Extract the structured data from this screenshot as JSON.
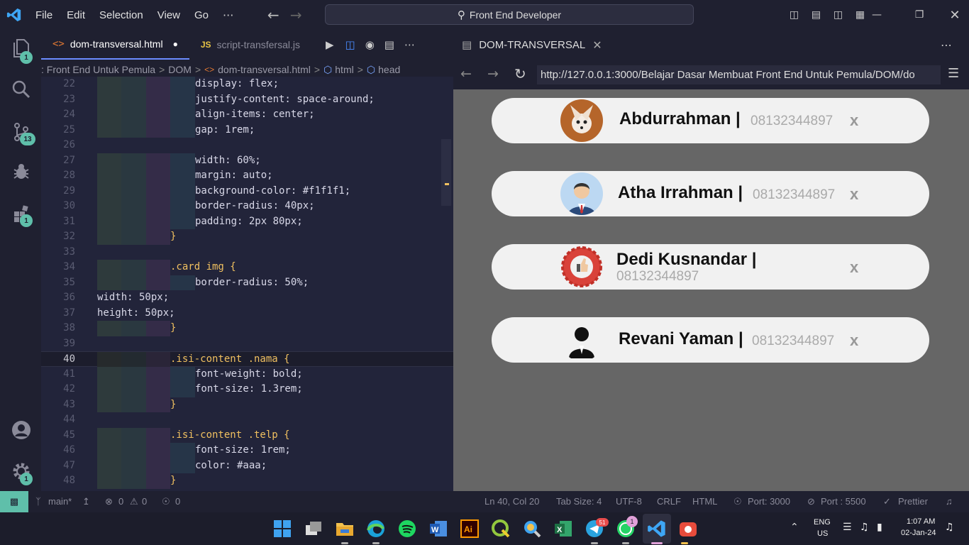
{
  "menu": {
    "file": "File",
    "edit": "Edit",
    "selection": "Selection",
    "view": "View",
    "go": "Go",
    "more": "···"
  },
  "search": {
    "text": "Front End Developer"
  },
  "activity": {
    "explorer_badge": "1",
    "scm_badge": "13",
    "extensions_badge": "1",
    "settings_badge": "1"
  },
  "editor_tabs": [
    {
      "label": "dom-transversal.html",
      "icon": "html-icon"
    },
    {
      "label": "script-transfersal.js",
      "icon": "JS"
    }
  ],
  "breadcrumb": [
    ": Front End Untuk Pemula",
    ">",
    "DOM",
    ">",
    "dom-transversal.html",
    ">",
    "html",
    ">",
    "head"
  ],
  "code_lines": [
    {
      "n": "22",
      "t": "display: flex;"
    },
    {
      "n": "23",
      "t": "justify-content: space-around;"
    },
    {
      "n": "24",
      "t": "align-items: center;"
    },
    {
      "n": "25",
      "t": "gap: 1rem;"
    },
    {
      "n": "26",
      "t": ""
    },
    {
      "n": "27",
      "t": "width: 60%;"
    },
    {
      "n": "28",
      "t": "margin: auto;"
    },
    {
      "n": "29",
      "t": "background-color: #f1f1f1;"
    },
    {
      "n": "30",
      "t": "border-radius: 40px;"
    },
    {
      "n": "31",
      "t": "padding: 2px 80px;"
    },
    {
      "n": "32",
      "t": "}"
    },
    {
      "n": "33",
      "t": ""
    },
    {
      "n": "34",
      "t": ".card img {"
    },
    {
      "n": "35",
      "t": "border-radius: 50%;"
    },
    {
      "n": "36",
      "t": "width: 50px;"
    },
    {
      "n": "37",
      "t": "height: 50px;"
    },
    {
      "n": "38",
      "t": "}"
    },
    {
      "n": "39",
      "t": ""
    },
    {
      "n": "40",
      "t": ".isi-content .nama {"
    },
    {
      "n": "41",
      "t": "font-weight: bold;"
    },
    {
      "n": "42",
      "t": "font-size: 1.3rem;"
    },
    {
      "n": "43",
      "t": "}"
    },
    {
      "n": "44",
      "t": ""
    },
    {
      "n": "45",
      "t": ".isi-content .telp {"
    },
    {
      "n": "46",
      "t": "font-size: 1rem;"
    },
    {
      "n": "47",
      "t": "color: #aaa;"
    },
    {
      "n": "48",
      "t": "}"
    }
  ],
  "browser": {
    "tab_title": "DOM-TRANSVERSAL",
    "url": "http://127.0.0.1:3000/Belajar Dasar Membuat Front End Untuk Pemula/DOM/do",
    "cards": [
      {
        "name": "Abdurrahman |",
        "phone": "08132344897",
        "close": "x"
      },
      {
        "name": "Atha Irrahman |",
        "phone": "08132344897",
        "close": "x"
      },
      {
        "name": "Dedi Kusnandar |",
        "phone": "08132344897",
        "close": "x"
      },
      {
        "name": "Revani Yaman |",
        "phone": "08132344897",
        "close": "x"
      }
    ]
  },
  "status": {
    "branch": "main*",
    "errors": "0",
    "warnings": "0",
    "ports": "0",
    "position": "Ln 40, Col 20",
    "tab_size": "Tab Size: 4",
    "encoding": "UTF-8",
    "eol": "CRLF",
    "language": "HTML",
    "port": "Port: 3000",
    "port2": "Port : 5500",
    "prettier": "Prettier"
  },
  "taskbar": {
    "lang": "ENG",
    "region": "US",
    "time": "1:07 AM",
    "date": "02-Jan-24",
    "telegram_badge": "51",
    "whatsapp_badge": "1"
  },
  "colors": {
    "accent": "#5fbfaa",
    "card_bg": "#f1f1f1",
    "editor_bg": "#22243a"
  }
}
